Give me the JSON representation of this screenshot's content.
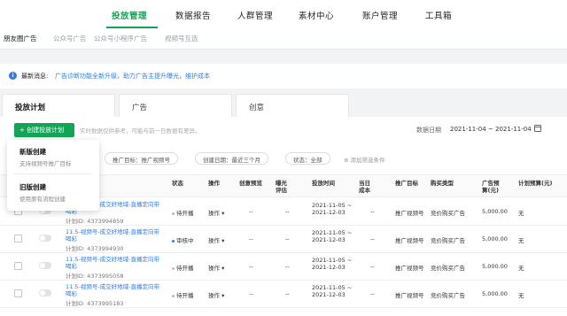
{
  "top_nav": {
    "tabs": [
      "投放管理",
      "数据报告",
      "人群管理",
      "素材中心",
      "账户管理",
      "工具箱"
    ],
    "active_index": 0
  },
  "sub_nav": [
    "朋友圈广告",
    "公众号广告",
    "公众号小程序广告",
    "视频号互选"
  ],
  "notice": {
    "label": "最新消息:",
    "text": "广告诊断功能全新升级，助力广告主提升曝光，维护成本"
  },
  "panel_tabs": [
    "投放计划",
    "广告",
    "创意"
  ],
  "toolbar": {
    "create_label": "+ 创建投放计划",
    "hint": "实时数据仅供参考，可能与前一日数据有差异。",
    "date_label": "数据日期",
    "date_range": "2021-11-04 ~ 2021-11-04"
  },
  "create_menu": [
    {
      "title": "新版创建",
      "desc": "支持视频号推广目标"
    },
    {
      "title": "旧版创建",
      "desc": "使用原有流程创建"
    }
  ],
  "filters": [
    "推广目标：推广视频号",
    "创建日期：最近三个月",
    "状态：全部"
  ],
  "add_filter": "⊕ 添加筛选条件",
  "columns": [
    "状态",
    "操作",
    "创意预览",
    "曝光评估",
    "投放时间",
    "当日成本",
    "推广目标",
    "购买类型",
    "广告预算(元)",
    "计划预算(元)"
  ],
  "rows": [
    {
      "name": "11.5-视频号-成交好地域-直播定向带喝彩",
      "id": "计划ID: 4373994859",
      "status": "待开播",
      "status_color": "#bbbbbb",
      "op": "操作 ▾",
      "preview": "--",
      "exposure": "--",
      "time": "2021-11-05 ~ 2021-12-03",
      "daily_cost": "--",
      "target": "推广视频号",
      "buy_type": "竞价购买广告",
      "budget": "5,000.00",
      "plan_budget": "无"
    },
    {
      "name": "11.5-视频号-成交好地域-直播定向带喝彩",
      "id": "计划ID: 4373994930",
      "status": "审核中",
      "status_color": "#2b7de9",
      "op": "操作 ▾",
      "preview": "--",
      "exposure": "--",
      "time": "2021-11-05 ~ 2021-12-03",
      "daily_cost": "--",
      "target": "推广视频号",
      "buy_type": "竞价购买广告",
      "budget": "5,000.00",
      "plan_budget": "无"
    },
    {
      "name": "11.5-视频号-成交好地域-直播定向带喝彩",
      "id": "计划ID: 4373995058",
      "status": "待开播",
      "status_color": "#bbbbbb",
      "op": "操作 ▾",
      "preview": "--",
      "exposure": "--",
      "time": "2021-11-05 ~ 2021-12-03",
      "daily_cost": "--",
      "target": "推广视频号",
      "buy_type": "竞价购买广告",
      "budget": "5,000.00",
      "plan_budget": "无"
    },
    {
      "name": "11.5-视频号-成交好地域-直播定向带喝彩",
      "id": "计划ID: 4373995183",
      "status": "待开播",
      "status_color": "#bbbbbb",
      "op": "操作 ▾",
      "preview": "--",
      "exposure": "--",
      "time": "2021-11-05 ~ 2021-12-03",
      "daily_cost": "--",
      "target": "推广视频号",
      "buy_type": "竞价购买广告",
      "budget": "5,000.00",
      "plan_budget": "无"
    }
  ],
  "colors": {
    "accent": "#13a556",
    "link": "#2b7de9"
  }
}
